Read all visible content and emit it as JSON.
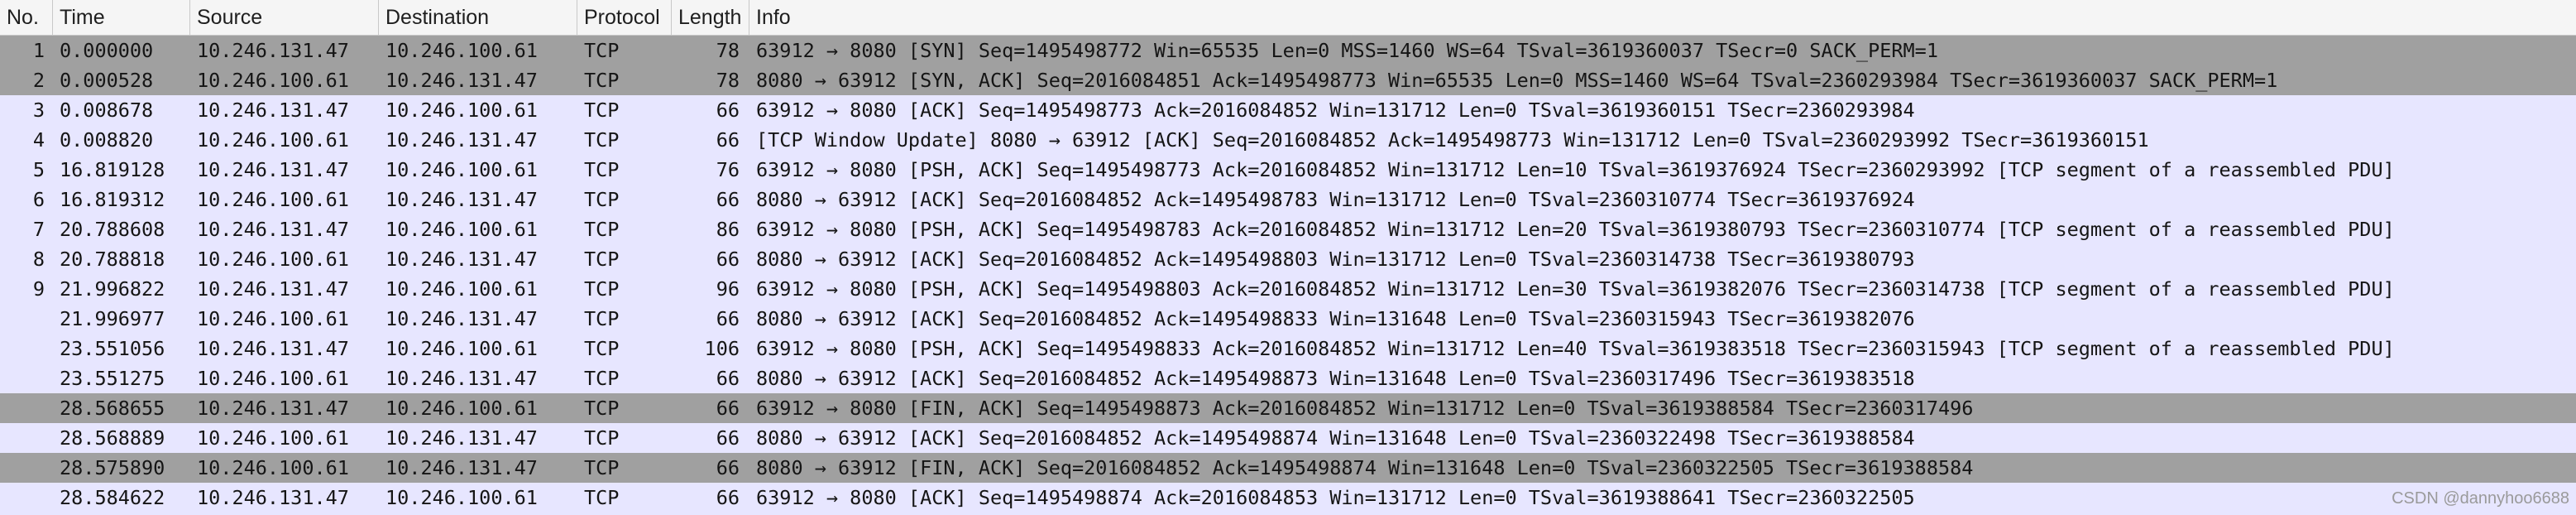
{
  "columns": {
    "no": "No.",
    "time": "Time",
    "source": "Source",
    "destination": "Destination",
    "protocol": "Protocol",
    "length": "Length",
    "info": "Info"
  },
  "colors": {
    "row_light": "#e7e6ff",
    "row_dark": "#a0a0a0"
  },
  "packets": [
    {
      "no": "1",
      "time": "0.000000",
      "source": "10.246.131.47",
      "destination": "10.246.100.61",
      "protocol": "TCP",
      "length": "78",
      "info": "63912 → 8080 [SYN] Seq=1495498772 Win=65535 Len=0 MSS=1460 WS=64 TSval=3619360037 TSecr=0 SACK_PERM=1",
      "shade": "dark"
    },
    {
      "no": "2",
      "time": "0.000528",
      "source": "10.246.100.61",
      "destination": "10.246.131.47",
      "protocol": "TCP",
      "length": "78",
      "info": "8080 → 63912 [SYN, ACK] Seq=2016084851 Ack=1495498773 Win=65535 Len=0 MSS=1460 WS=64 TSval=2360293984 TSecr=3619360037 SACK_PERM=1",
      "shade": "dark"
    },
    {
      "no": "3",
      "time": "0.008678",
      "source": "10.246.131.47",
      "destination": "10.246.100.61",
      "protocol": "TCP",
      "length": "66",
      "info": "63912 → 8080 [ACK] Seq=1495498773 Ack=2016084852 Win=131712 Len=0 TSval=3619360151 TSecr=2360293984",
      "shade": "light"
    },
    {
      "no": "4",
      "time": "0.008820",
      "source": "10.246.100.61",
      "destination": "10.246.131.47",
      "protocol": "TCP",
      "length": "66",
      "info": "[TCP Window Update] 8080 → 63912 [ACK] Seq=2016084852 Ack=1495498773 Win=131712 Len=0 TSval=2360293992 TSecr=3619360151",
      "shade": "light"
    },
    {
      "no": "5",
      "time": "16.819128",
      "source": "10.246.131.47",
      "destination": "10.246.100.61",
      "protocol": "TCP",
      "length": "76",
      "info": "63912 → 8080 [PSH, ACK] Seq=1495498773 Ack=2016084852 Win=131712 Len=10 TSval=3619376924 TSecr=2360293992 [TCP segment of a reassembled PDU]",
      "shade": "light"
    },
    {
      "no": "6",
      "time": "16.819312",
      "source": "10.246.100.61",
      "destination": "10.246.131.47",
      "protocol": "TCP",
      "length": "66",
      "info": "8080 → 63912 [ACK] Seq=2016084852 Ack=1495498783 Win=131712 Len=0 TSval=2360310774 TSecr=3619376924",
      "shade": "light"
    },
    {
      "no": "7",
      "time": "20.788608",
      "source": "10.246.131.47",
      "destination": "10.246.100.61",
      "protocol": "TCP",
      "length": "86",
      "info": "63912 → 8080 [PSH, ACK] Seq=1495498783 Ack=2016084852 Win=131712 Len=20 TSval=3619380793 TSecr=2360310774 [TCP segment of a reassembled PDU]",
      "shade": "light"
    },
    {
      "no": "8",
      "time": "20.788818",
      "source": "10.246.100.61",
      "destination": "10.246.131.47",
      "protocol": "TCP",
      "length": "66",
      "info": "8080 → 63912 [ACK] Seq=2016084852 Ack=1495498803 Win=131712 Len=0 TSval=2360314738 TSecr=3619380793",
      "shade": "light"
    },
    {
      "no": "9",
      "time": "21.996822",
      "source": "10.246.131.47",
      "destination": "10.246.100.61",
      "protocol": "TCP",
      "length": "96",
      "info": "63912 → 8080 [PSH, ACK] Seq=1495498803 Ack=2016084852 Win=131712 Len=30 TSval=3619382076 TSecr=2360314738 [TCP segment of a reassembled PDU]",
      "shade": "light"
    },
    {
      "no": "",
      "time": "21.996977",
      "source": "10.246.100.61",
      "destination": "10.246.131.47",
      "protocol": "TCP",
      "length": "66",
      "info": "8080 → 63912 [ACK] Seq=2016084852 Ack=1495498833 Win=131648 Len=0 TSval=2360315943 TSecr=3619382076",
      "shade": "light"
    },
    {
      "no": "",
      "time": "23.551056",
      "source": "10.246.131.47",
      "destination": "10.246.100.61",
      "protocol": "TCP",
      "length": "106",
      "info": "63912 → 8080 [PSH, ACK] Seq=1495498833 Ack=2016084852 Win=131712 Len=40 TSval=3619383518 TSecr=2360315943 [TCP segment of a reassembled PDU]",
      "shade": "light"
    },
    {
      "no": "",
      "time": "23.551275",
      "source": "10.246.100.61",
      "destination": "10.246.131.47",
      "protocol": "TCP",
      "length": "66",
      "info": "8080 → 63912 [ACK] Seq=2016084852 Ack=1495498873 Win=131648 Len=0 TSval=2360317496 TSecr=3619383518",
      "shade": "light"
    },
    {
      "no": "",
      "time": "28.568655",
      "source": "10.246.131.47",
      "destination": "10.246.100.61",
      "protocol": "TCP",
      "length": "66",
      "info": "63912 → 8080 [FIN, ACK] Seq=1495498873 Ack=2016084852 Win=131712 Len=0 TSval=3619388584 TSecr=2360317496",
      "shade": "dark"
    },
    {
      "no": "",
      "time": "28.568889",
      "source": "10.246.100.61",
      "destination": "10.246.131.47",
      "protocol": "TCP",
      "length": "66",
      "info": "8080 → 63912 [ACK] Seq=2016084852 Ack=1495498874 Win=131648 Len=0 TSval=2360322498 TSecr=3619388584",
      "shade": "light"
    },
    {
      "no": "",
      "time": "28.575890",
      "source": "10.246.100.61",
      "destination": "10.246.131.47",
      "protocol": "TCP",
      "length": "66",
      "info": "8080 → 63912 [FIN, ACK] Seq=2016084852 Ack=1495498874 Win=131648 Len=0 TSval=2360322505 TSecr=3619388584",
      "shade": "dark"
    },
    {
      "no": "",
      "time": "28.584622",
      "source": "10.246.131.47",
      "destination": "10.246.100.61",
      "protocol": "TCP",
      "length": "66",
      "info": "63912 → 8080 [ACK] Seq=1495498874 Ack=2016084853 Win=131712 Len=0 TSval=3619388641 TSecr=2360322505",
      "shade": "light"
    }
  ],
  "watermark": "CSDN @dannyhoo6688"
}
